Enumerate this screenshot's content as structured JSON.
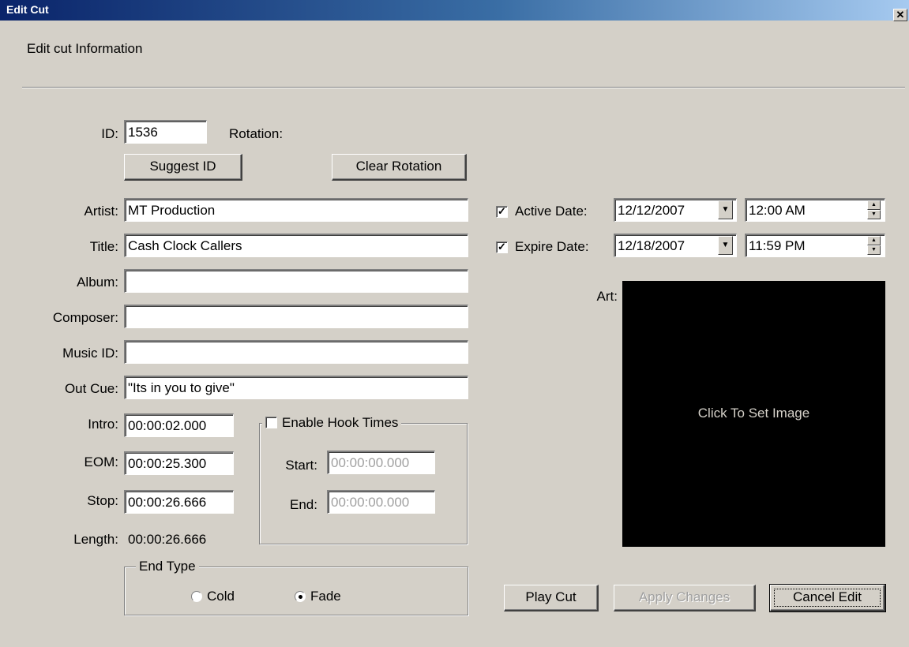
{
  "window": {
    "title": "Edit Cut",
    "close_glyph": "✕"
  },
  "header": {
    "subtitle": "Edit cut Information"
  },
  "form": {
    "id_label": "ID:",
    "id_value": "1536",
    "rotation_label": "Rotation:",
    "suggest_id_label": "Suggest ID",
    "clear_rotation_label": "Clear Rotation",
    "artist_label": "Artist:",
    "artist_value": "MT Production",
    "title_label": "Title:",
    "title_value": "Cash Clock Callers",
    "album_label": "Album:",
    "album_value": "",
    "composer_label": "Composer:",
    "composer_value": "",
    "music_id_label": "Music ID:",
    "music_id_value": "",
    "out_cue_label": "Out Cue:",
    "out_cue_value": "\"Its in you to give\"",
    "intro_label": "Intro:",
    "intro_value": "00:00:02.000",
    "eom_label": "EOM:",
    "eom_value": "00:00:25.300",
    "stop_label": "Stop:",
    "stop_value": "00:00:26.666",
    "length_label": "Length:",
    "length_value": "00:00:26.666"
  },
  "hook": {
    "enable_label": "Enable Hook Times",
    "enabled": false,
    "start_label": "Start:",
    "start_value": "00:00:00.000",
    "end_label": "End:",
    "end_value": "00:00:00.000"
  },
  "end_type": {
    "title": "End Type",
    "options": [
      {
        "label": "Cold",
        "selected": false
      },
      {
        "label": "Fade",
        "selected": true
      }
    ]
  },
  "dates": {
    "active_label": "Active Date:",
    "active_checked": true,
    "active_date": "12/12/2007",
    "active_time": "12:00 AM",
    "expire_label": "Expire Date:",
    "expire_checked": true,
    "expire_date": "12/18/2007",
    "expire_time": "11:59 PM"
  },
  "art": {
    "label": "Art:",
    "placeholder": "Click To Set Image"
  },
  "actions": {
    "play_cut_label": "Play Cut",
    "apply_changes_label": "Apply Changes",
    "cancel_edit_label": "Cancel Edit"
  },
  "glyphs": {
    "check": "✓",
    "dropdown": "▼",
    "spin_up": "▲",
    "spin_down": "▼"
  },
  "colors": {
    "dialog_bg": "#d4d0c8",
    "titlebar_start": "#0a246a",
    "titlebar_end": "#a6caf0",
    "art_bg": "#000000",
    "disabled_text": "#a0a0a0"
  }
}
